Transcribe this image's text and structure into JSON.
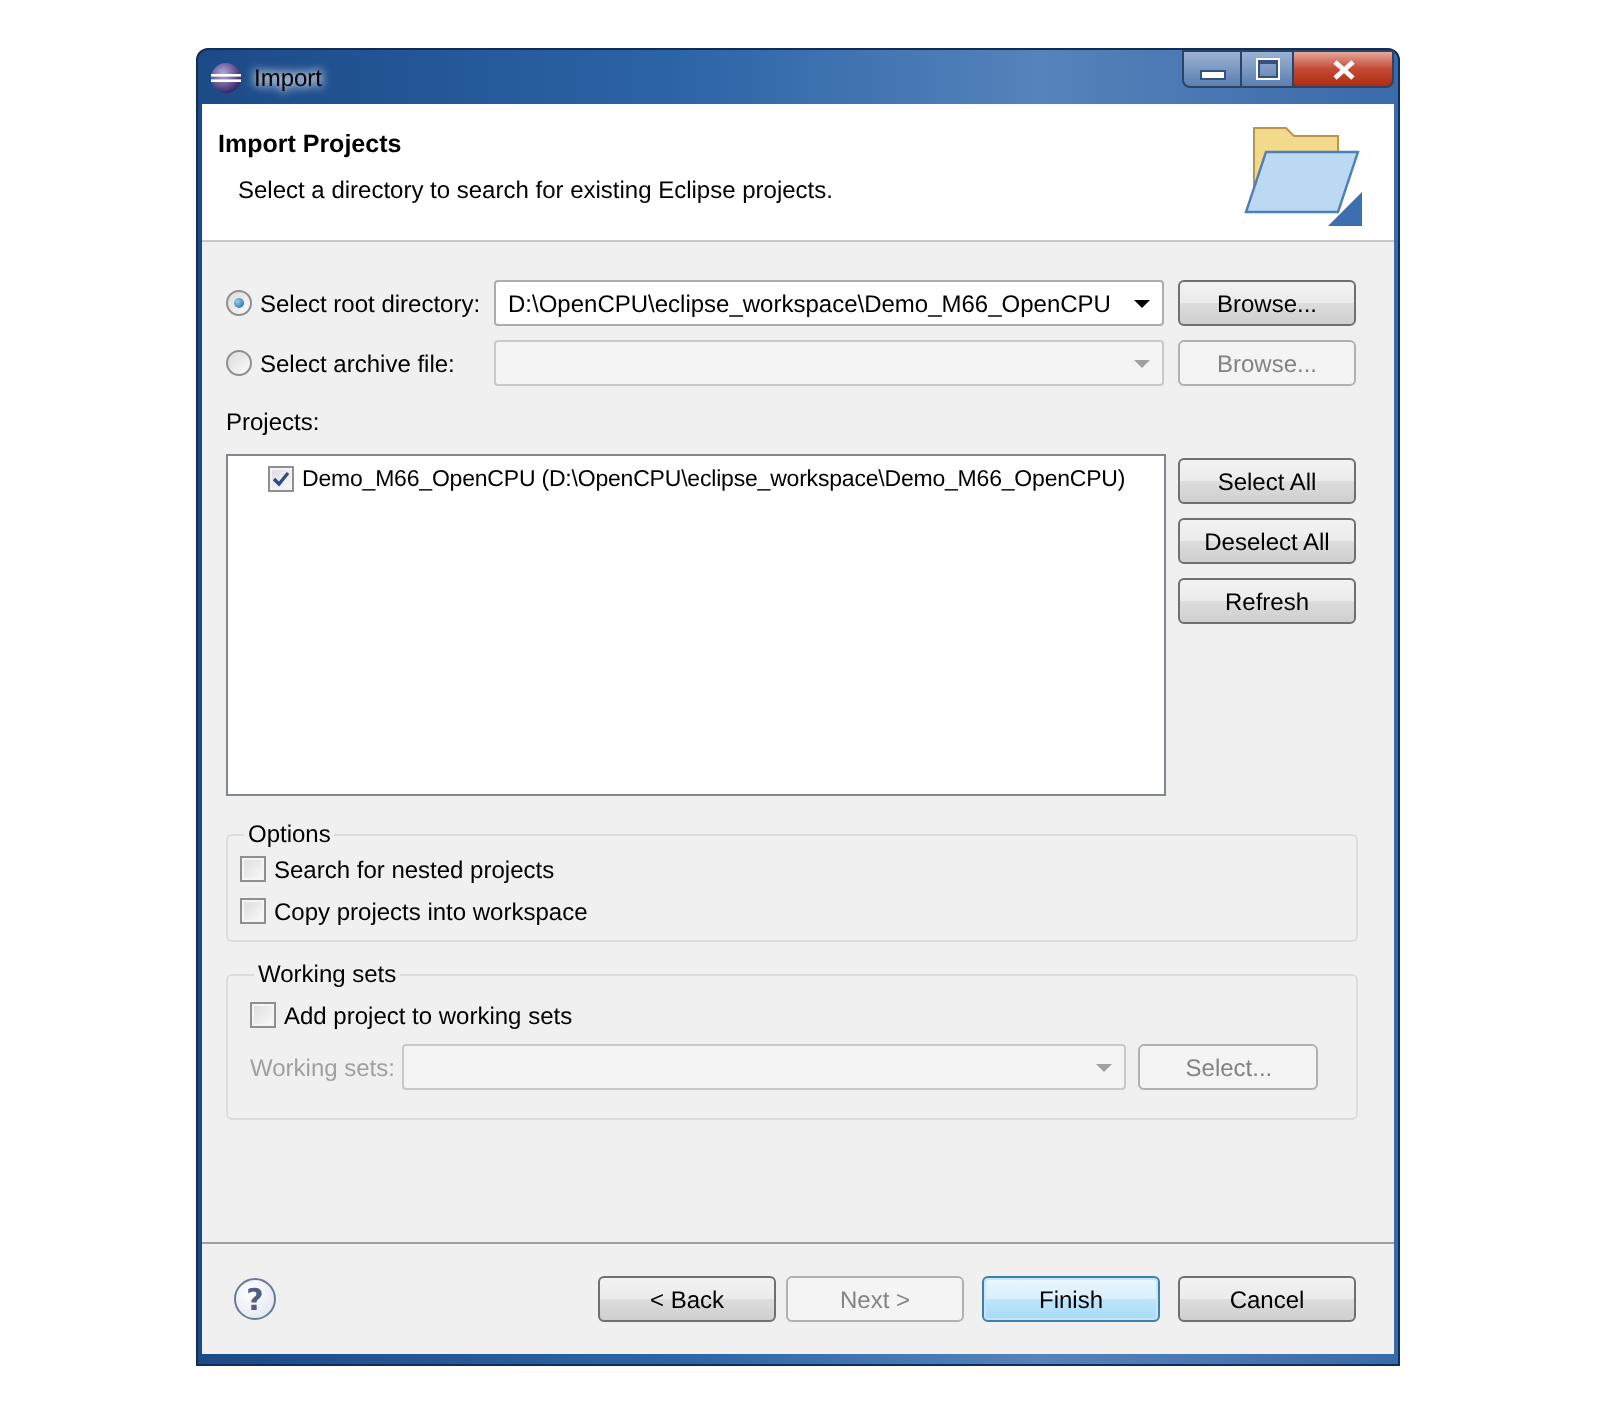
{
  "window": {
    "title": "Import"
  },
  "header": {
    "title": "Import Projects",
    "description": "Select a directory to search for existing Eclipse projects."
  },
  "source": [
    {
      "label": "Select root directory:",
      "selected": true,
      "value": "D:\\OpenCPU\\eclipse_workspace\\Demo_M66_OpenCPU",
      "disabled": false,
      "button": "Browse..."
    },
    {
      "label": "Select archive file:",
      "selected": false,
      "disabled": true,
      "button": "Browse..."
    }
  ],
  "projects": {
    "label": "Projects:",
    "items": [
      {
        "label": "Demo_M66_OpenCPU (D:\\OpenCPU\\eclipse_workspace\\Demo_M66_OpenCPU)",
        "checked": true
      }
    ],
    "buttons": [
      "Select All",
      "Deselect All",
      "Refresh"
    ]
  },
  "options": {
    "title": "Options",
    "items": [
      {
        "label": "Search for nested projects",
        "checked": false
      },
      {
        "label": "Copy projects into workspace",
        "checked": false
      }
    ]
  },
  "working_sets": {
    "title": "Working sets",
    "add": {
      "label": "Add project to working sets",
      "checked": false
    },
    "field_label": "Working sets:",
    "disabled": true,
    "button": "Select..."
  },
  "footer": {
    "help": "?",
    "buttons": [
      {
        "label": "< Back",
        "disabled": false,
        "default": false
      },
      {
        "label": "Next >",
        "disabled": true,
        "default": false
      },
      {
        "label": "Finish",
        "disabled": false,
        "default": true
      },
      {
        "label": "Cancel",
        "disabled": false,
        "default": false
      }
    ]
  }
}
